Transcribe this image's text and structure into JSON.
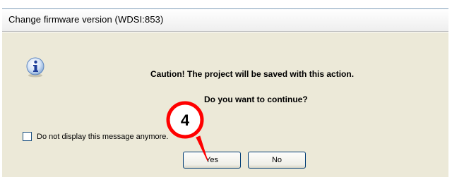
{
  "window": {
    "title": "Change firmware version (WDSI:853)"
  },
  "message": {
    "line1": "Caution! The project will be saved with this action.",
    "line2": "Do you want to continue?"
  },
  "options": {
    "dont_show_label": "Do not display this message anymore.",
    "dont_show_checked": false
  },
  "buttons": {
    "yes_label": "Yes",
    "no_label": "No"
  },
  "annotation": {
    "step_number": "4",
    "color": "#ff0000"
  },
  "icons": {
    "dialog_icon": "info-icon"
  }
}
